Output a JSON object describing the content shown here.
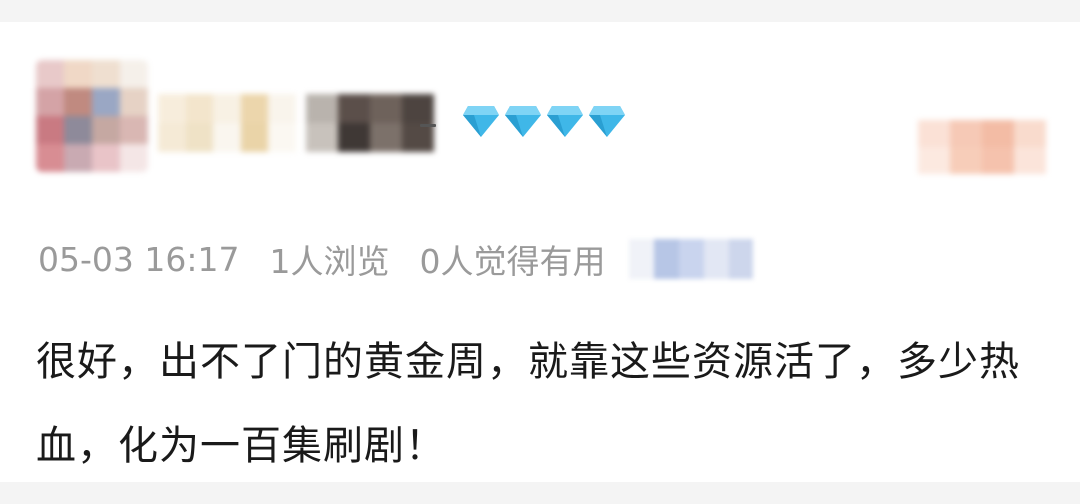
{
  "review": {
    "timestamp": "05-03 16:17",
    "views": "1人浏览",
    "helpful": "0人觉得有用",
    "comment": "很好，出不了门的黄金周，就靠这些资源活了，多少热血，化为一百集刷剧！"
  },
  "icons": {
    "avatar": "blurred-avatar",
    "level_badge": "diamond-icon",
    "level_count": 4
  },
  "colors": {
    "diamond": "#3fb7e8",
    "meta_text": "#9a9a9a",
    "body_text": "#1a1a1a",
    "separator": "#f4f4f4"
  }
}
